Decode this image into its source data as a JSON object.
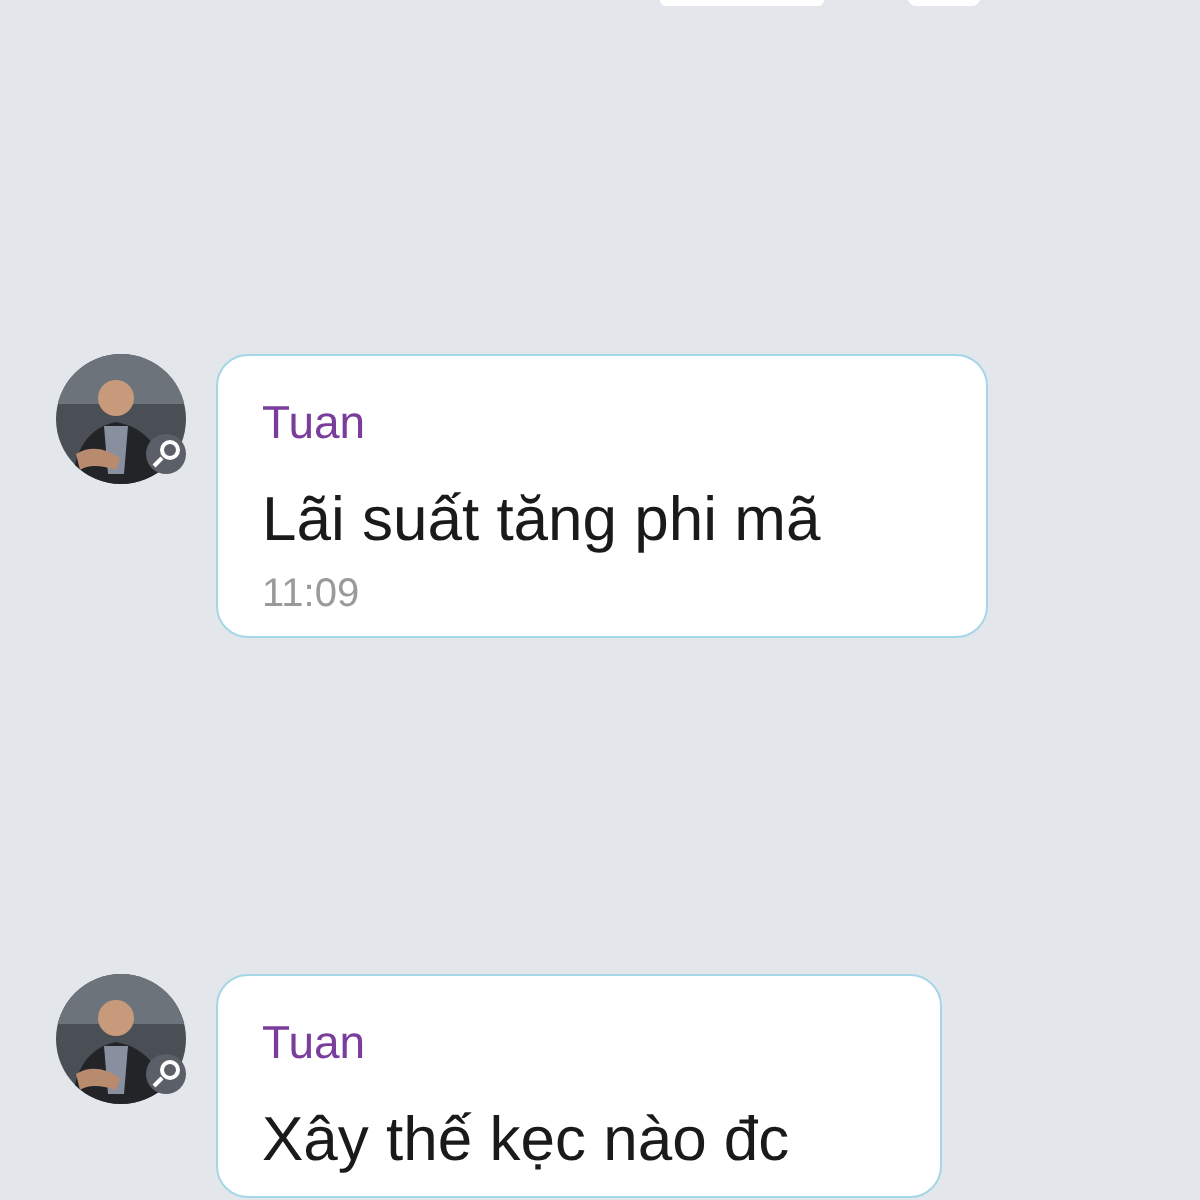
{
  "messages": [
    {
      "sender": "Tuan",
      "text": "Lãi suất tăng phi mã",
      "time": "11:09"
    },
    {
      "sender": "Tuan",
      "text": "Xây thế kẹc nào đc"
    }
  ]
}
